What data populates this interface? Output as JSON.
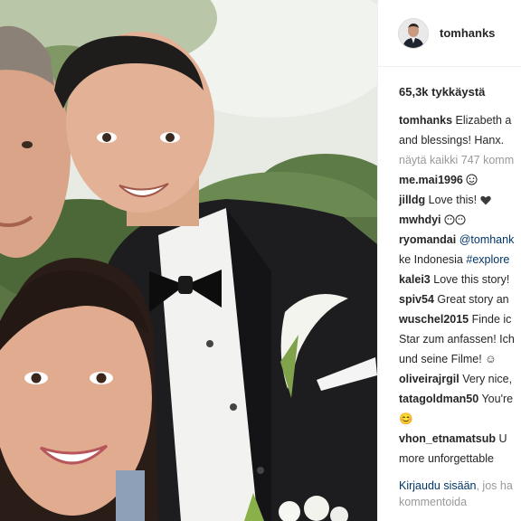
{
  "post": {
    "username": "tomhanks",
    "likes": "65,3k tykkäystä",
    "caption": {
      "user": "tomhanks",
      "text": "Elizabeth a",
      "continuation": "and blessings! Hanx."
    },
    "view_all": "näytä kaikki 747 komm",
    "comments": [
      {
        "user": "me.mai1996",
        "text": "",
        "icon": "smiley-icon"
      },
      {
        "user": "jilldg",
        "text": "Love this!",
        "icon": "heart-icon"
      },
      {
        "user": "mwhdyi",
        "text": "",
        "icon": "eyes-emoji-icon"
      },
      {
        "user": "ryomandai",
        "mention": "@tomhank",
        "line2": "ke Indonesia",
        "hashtag": "#explore"
      },
      {
        "user": "kalei3",
        "text": "Love this story!"
      },
      {
        "user": "spiv54",
        "text": "Great story an"
      },
      {
        "user": "wuschel2015",
        "text": "Finde ic",
        "line2": "Star zum anfassen! Ich",
        "line3": "und seine Filme! ☺"
      },
      {
        "user": "oliveirajrgil",
        "text": "Very nice,"
      },
      {
        "user": "tatagoldman50",
        "text": "You're",
        "line2": "😊"
      },
      {
        "user": "vhon_etnamatsub",
        "text": "U",
        "line2": "more unforgettable"
      }
    ],
    "footer": {
      "login": "Kirjaudu sisään",
      "rest": ", jos ha",
      "line2": "kommentoida"
    }
  }
}
